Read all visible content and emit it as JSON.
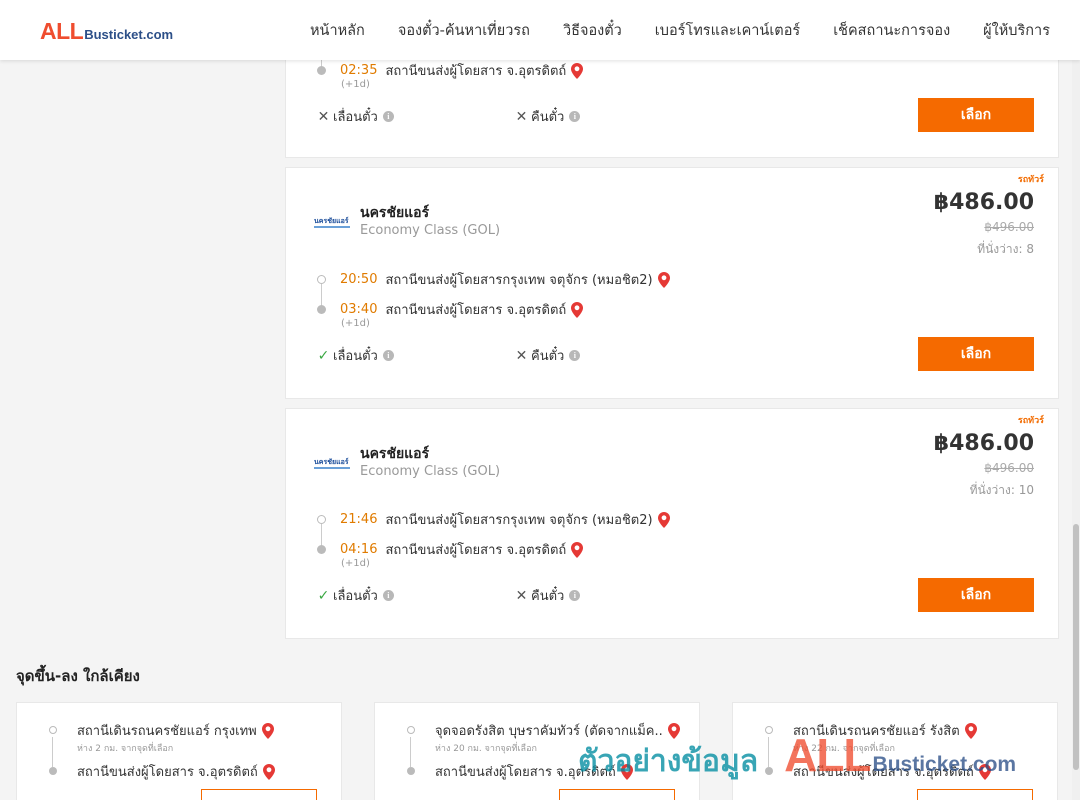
{
  "header": {
    "logo_all": "ALL",
    "logo_busticket": "Busticket.com",
    "nav": [
      "หน้าหลัก",
      "จองตั๋ว-ค้นหาเที่ยวรถ",
      "วิธีจองตั๋ว",
      "เบอร์โทรและเคาน์เตอร์",
      "เช็คสถานะการจอง",
      "ผู้ให้บริการ"
    ]
  },
  "trip_top": {
    "arrive_time": "02:35",
    "arrive_station": "สถานีขนส่งผู้โดยสาร จ.อุตรดิตถ์",
    "plus_day": "(+1d)",
    "reschedule": "เลื่อนตั๋ว",
    "reschedule_allowed": false,
    "refund": "คืนตั๋ว",
    "refund_allowed": false,
    "select_label": "เลือก"
  },
  "trips": [
    {
      "tag": "รถทัวร์",
      "operator": "นครชัยแอร์",
      "operator_logo_text": "นครชัยแอร์",
      "bus_class": "Economy Class (GOL)",
      "price": "฿486.00",
      "old_price": "฿496.00",
      "seats": "ที่นั่งว่าง: 8",
      "depart_time": "20:50",
      "depart_station": "สถานีขนส่งผู้โดยสารกรุงเทพ จตุจักร (หมอชิต2)",
      "arrive_time": "03:40",
      "arrive_station": "สถานีขนส่งผู้โดยสาร จ.อุตรดิตถ์",
      "plus_day": "(+1d)",
      "reschedule": "เลื่อนตั๋ว",
      "reschedule_allowed": true,
      "refund": "คืนตั๋ว",
      "refund_allowed": false,
      "select_label": "เลือก"
    },
    {
      "tag": "รถทัวร์",
      "operator": "นครชัยแอร์",
      "operator_logo_text": "นครชัยแอร์",
      "bus_class": "Economy Class (GOL)",
      "price": "฿486.00",
      "old_price": "฿496.00",
      "seats": "ที่นั่งว่าง: 10",
      "depart_time": "21:46",
      "depart_station": "สถานีขนส่งผู้โดยสารกรุงเทพ จตุจักร (หมอชิต2)",
      "arrive_time": "04:16",
      "arrive_station": "สถานีขนส่งผู้โดยสาร จ.อุตรดิตถ์",
      "plus_day": "(+1d)",
      "reschedule": "เลื่อนตั๋ว",
      "reschedule_allowed": true,
      "refund": "คืนตั๋ว",
      "refund_allowed": false,
      "select_label": "เลือก"
    }
  ],
  "nearby": {
    "title": "จุดขึ้น-ลง ใกล้เคียง",
    "items": [
      {
        "from": "สถานีเดินรถนครชัยแอร์ กรุงเทพ",
        "distance": "ห่าง 2 กม. จากจุดที่เลือก",
        "to": "สถานีขนส่งผู้โดยสาร จ.อุตรดิตถ์"
      },
      {
        "from": "จุดจอดรังสิต บุษราคัมทัวร์ (ตัดจากแม็ค..",
        "distance": "ห่าง 20 กม. จากจุดที่เลือก",
        "to": "สถานีขนส่งผู้โดยสาร จ.อุตรดิตถ์"
      },
      {
        "from": "สถานีเดินรถนครชัยแอร์ รังสิต",
        "distance": "ห่าง 22 กม. จากจุดที่เลือก",
        "to": "สถานีขนส่งผู้โดยสาร จ.อุตรดิตถ์"
      }
    ]
  },
  "watermark": {
    "thai": "ตัวอย่างข้อมูล",
    "all": "ALL",
    "busticket": "Busticket.com"
  },
  "colors": {
    "accent": "#f56a00",
    "time": "#e07b00",
    "brand_red": "#ef4d2f",
    "brand_blue": "#2c4f88",
    "pin": "#e53935",
    "check": "#3aa843"
  },
  "icons": {
    "pin": "map-pin-icon",
    "check": "check-icon",
    "cross": "cross-icon",
    "info": "info-icon"
  }
}
